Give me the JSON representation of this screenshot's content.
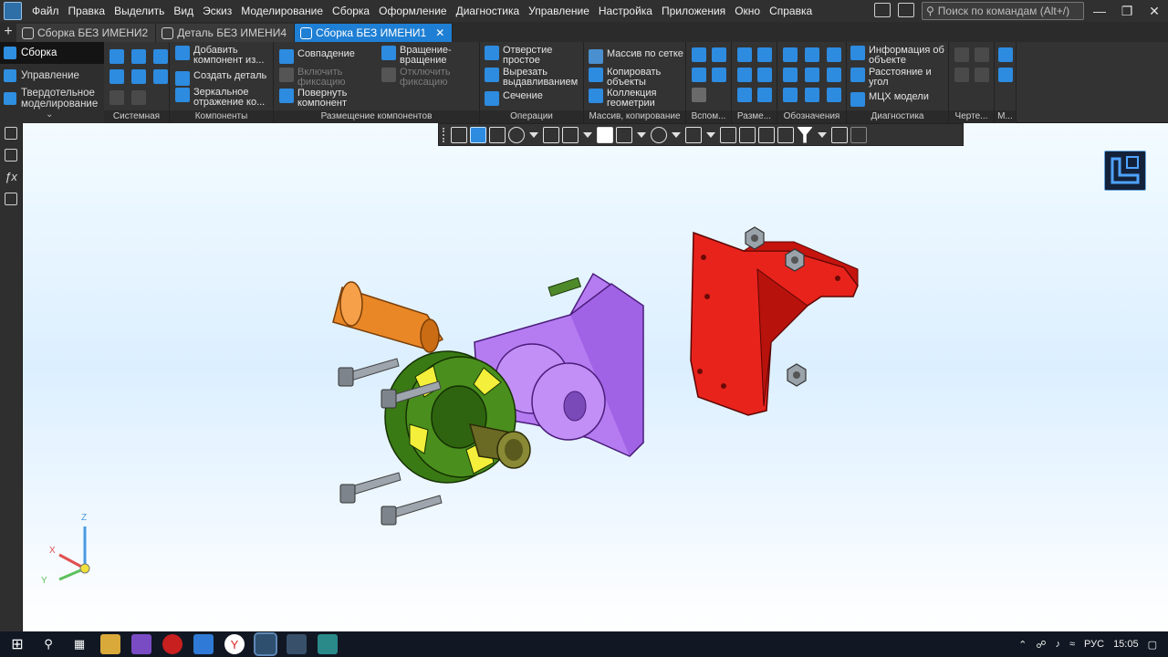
{
  "menubar": {
    "items": [
      "Файл",
      "Правка",
      "Выделить",
      "Вид",
      "Эскиз",
      "Моделирование",
      "Сборка",
      "Оформление",
      "Диагностика",
      "Управление",
      "Настройка",
      "Приложения",
      "Окно",
      "Справка"
    ],
    "search_placeholder": "Поиск по командам (Alt+/)"
  },
  "tabs": [
    {
      "label": "Сборка БЕЗ ИМЕНИ2",
      "active": false
    },
    {
      "label": "Деталь БЕЗ ИМЕНИ4",
      "active": false
    },
    {
      "label": "Сборка БЕЗ ИМЕНИ1",
      "active": true
    }
  ],
  "ribbon_left": {
    "items": [
      "Сборка",
      "Управление",
      "Твердотельное моделирование"
    ]
  },
  "ribbon": {
    "groups": [
      "Системная",
      "Компоненты",
      "Размещение компонентов",
      "Операции",
      "Массив, копирование",
      "Вспом...",
      "Разме...",
      "Обозначения",
      "Диагностика",
      "Черте...",
      "М..."
    ],
    "components": [
      "Добавить компонент из...",
      "Создать деталь",
      "Зеркальное отражение ко..."
    ],
    "placement": {
      "coincidence": "Совпадение",
      "fix": "Включить фиксацию",
      "rotate": "Повернуть компонент",
      "rotation": "Вращение-вращение",
      "unfix": "Отключить фиксацию"
    },
    "operations": [
      "Отверстие простое",
      "Вырезать выдавливанием",
      "Сечение"
    ],
    "pattern": [
      "Массив по сетке",
      "Копировать объекты",
      "Коллекция геометрии"
    ],
    "diagnostics": [
      "Информация об объекте",
      "Расстояние и угол",
      "МЦХ модели"
    ]
  },
  "axes": {
    "x": "X",
    "y": "Y",
    "z": "Z"
  },
  "taskbar": {
    "lang": "РУС",
    "time": "15:05"
  },
  "colors": {
    "accent": "#1e7fd4",
    "purple_part": "#b57cf2",
    "red_part": "#e8231c",
    "green_part": "#3a7a14",
    "orange_part": "#e98726"
  }
}
